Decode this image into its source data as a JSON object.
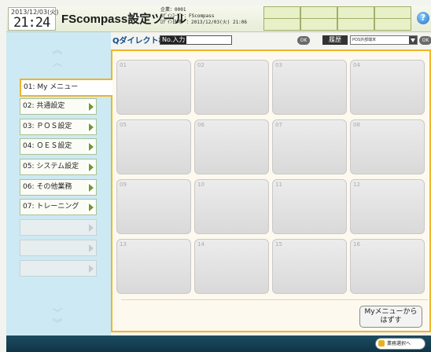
{
  "header": {
    "date": "2013/12/03(火)",
    "time": "21:24",
    "app_title": "FScompass設定ツール",
    "info_lines": [
      "企業：0001",
      "ﾛｸﾞｲﾝﾕｰｻﾞｰ：FScompass",
      "ﾛｸﾞｲﾝ日時　：2013/12/03(火) 21:06"
    ],
    "help_label": "?"
  },
  "toolbar": {
    "search_label": "Qダイレクト検索",
    "search_placeholder": "No.入力",
    "ok_label": "OK",
    "history_label": "履歴",
    "dropdown_value": "POS外部端末"
  },
  "sidebar": {
    "items": [
      {
        "label": "01: My メニュー",
        "active": true
      },
      {
        "label": "02: 共通設定"
      },
      {
        "label": "03: ＰＯＳ設定"
      },
      {
        "label": "04: ＯＥＳ設定"
      },
      {
        "label": "05: システム設定"
      },
      {
        "label": "06: その他業務"
      },
      {
        "label": "07: トレーニング"
      },
      {
        "label": ""
      },
      {
        "label": ""
      },
      {
        "label": ""
      }
    ]
  },
  "tiles": [
    "01",
    "02",
    "03",
    "04",
    "05",
    "06",
    "07",
    "08",
    "09",
    "10",
    "11",
    "12",
    "13",
    "14",
    "15",
    "16"
  ],
  "my_menu_button": {
    "line1": "Myメニューから",
    "line2": "はずす"
  },
  "footer": {
    "business_select_label": "業務選択へ"
  },
  "colors": {
    "accent": "#efb52a",
    "sidebar_bg": "#cde9f3",
    "footer_bg": "#12394c",
    "nav_arrow": "#6e9a2a"
  }
}
